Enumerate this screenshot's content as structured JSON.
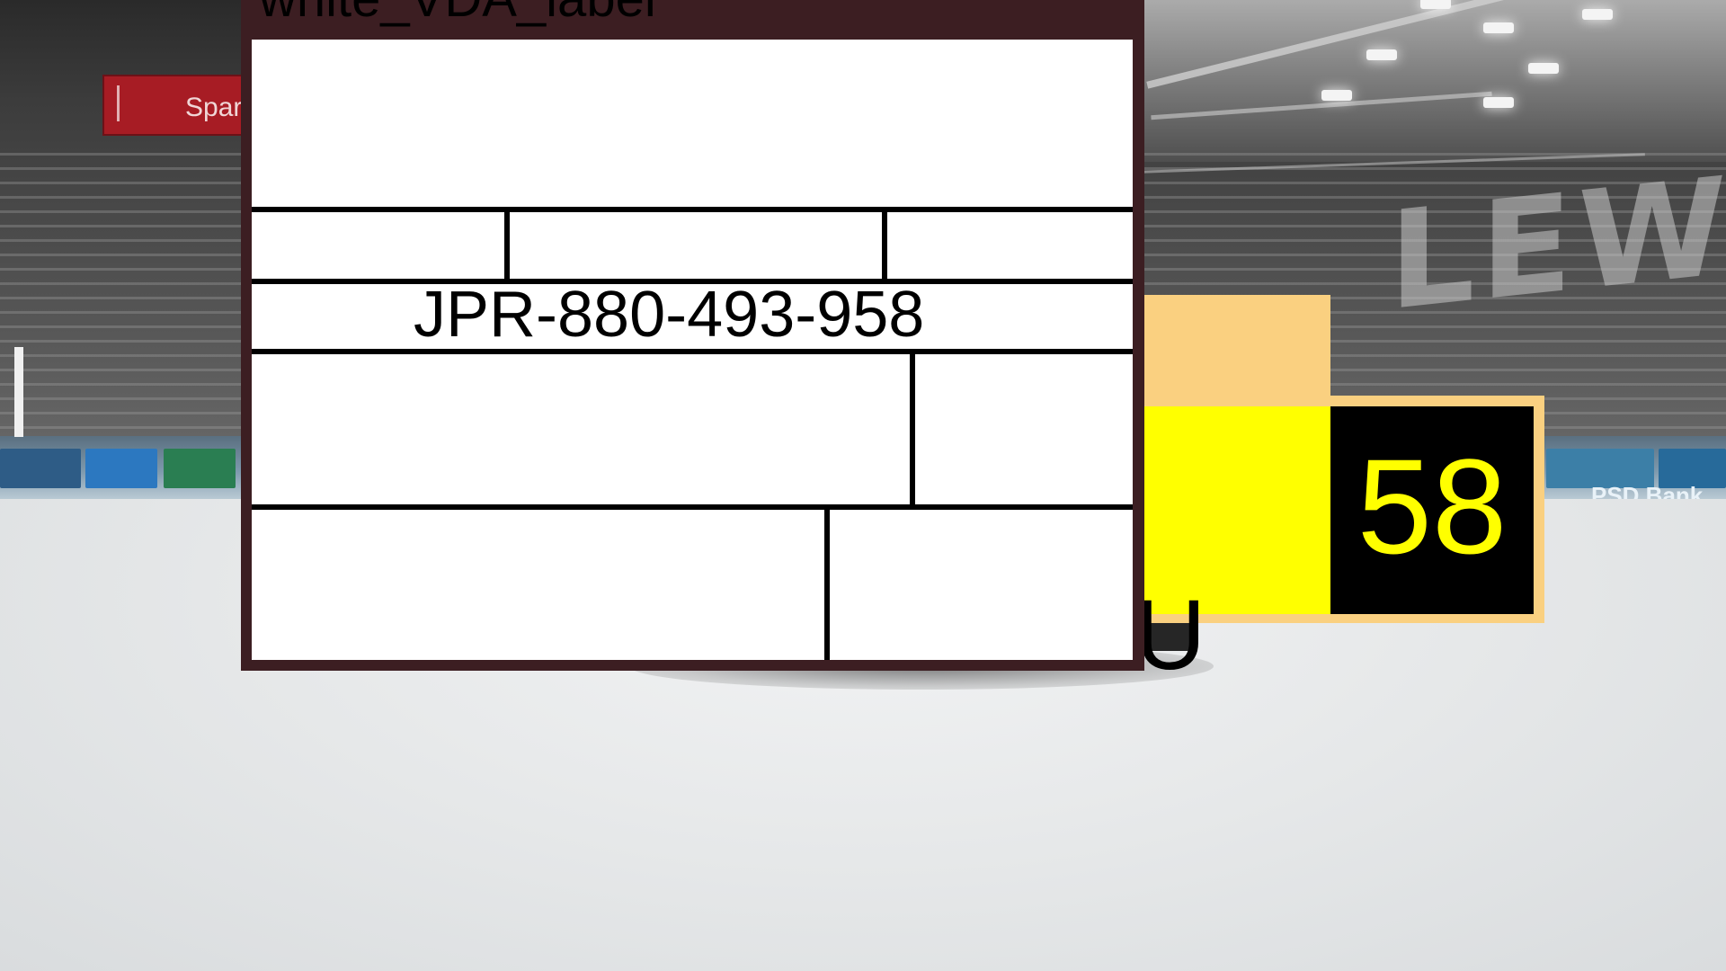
{
  "overlay_label": {
    "title": "white_VDA_label",
    "code": "JPR-880-493-958"
  },
  "scoreboard": {
    "team_text": "U",
    "score": "58",
    "colors": {
      "frame": "#fad080",
      "team_background": "#ffff00",
      "score_background": "#000000",
      "score_text": "#ffff00"
    }
  },
  "background": {
    "arena_lettering": "LEW",
    "sponsor_sign_text": "Spar",
    "ad_board_text": "PSD Bank"
  }
}
